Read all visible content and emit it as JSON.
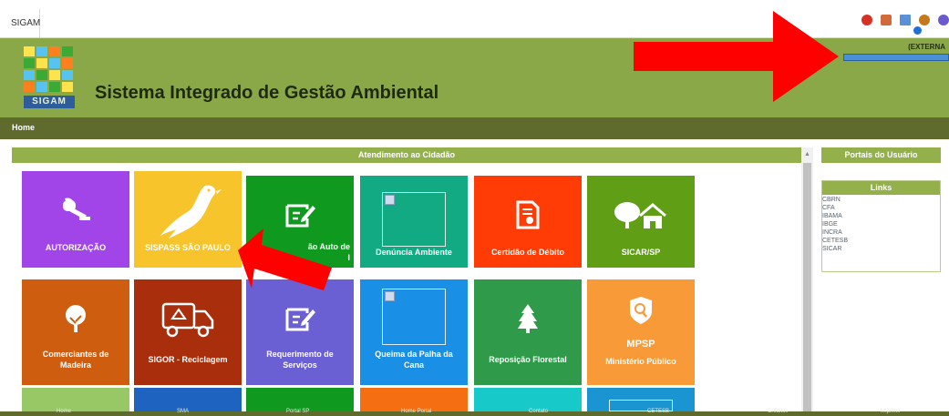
{
  "topbar": {
    "app_label": "SIGAM"
  },
  "header": {
    "logo_text": "SIGAM",
    "title": "Sistema Integrado de Gestão Ambiental",
    "user_type": "(EXTERNA"
  },
  "nav": {
    "home": "Home"
  },
  "panel": {
    "title": "Atendimento ao Cidadão"
  },
  "tiles": [
    {
      "label": "AUTORIZAÇÃO",
      "color": "#a144e8"
    },
    {
      "label": "SISPASS SÃO PAULO",
      "color": "#f7c42b"
    },
    {
      "label": "ão Auto de\nl",
      "color": "#0f9a1f"
    },
    {
      "label": "Denúncia Ambiente",
      "color": "#11aa82"
    },
    {
      "label": "Certidão de Débito",
      "color": "#ff3c05"
    },
    {
      "label": "SICAR/SP",
      "color": "#5f9e15"
    },
    {
      "label": "Comerciantes de\nMadeira",
      "color": "#cf5d0f"
    },
    {
      "label": "SIGOR - Reciclagem",
      "color": "#a92f0c"
    },
    {
      "label": "Requerimento de\nServiços",
      "color": "#6a5fd3"
    },
    {
      "label": "Queima da Palha da\nCana",
      "color": "#1a8fe6"
    },
    {
      "label": "Reposição Florestal",
      "color": "#2e9a4a"
    },
    {
      "label": "Ministério Público",
      "sublabel": "MPSP",
      "color": "#f99a39"
    }
  ],
  "tiles_row3_colors": [
    "#98c766",
    "#1e63c0",
    "#0f9a1f",
    "#f56f12",
    "#18c9c9",
    "#1a95d2"
  ],
  "sidebar": {
    "portals_title": "Portais do Usuário",
    "links_title": "Links",
    "links": [
      "CBRN",
      "CFA",
      "IBAMA",
      "IBGE",
      "INCRA",
      "CETESB",
      "SICAR"
    ]
  },
  "footer": {
    "items": [
      "Home",
      "SMA",
      "Portal SP",
      "Home Portal",
      "Contato",
      "CETESB",
      "Créditos",
      "Imprimir"
    ]
  },
  "icons": {
    "close": "close-icon",
    "home": "home-icon",
    "mail": "mail-icon",
    "user": "user-icon",
    "help": "help-icon",
    "settings": "settings-icon"
  }
}
